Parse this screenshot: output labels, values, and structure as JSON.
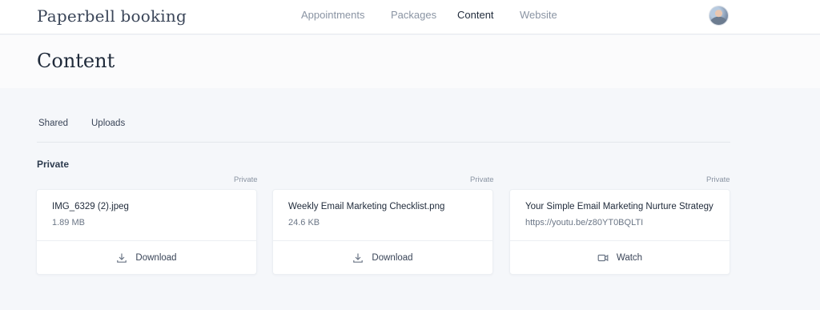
{
  "app": {
    "brand": "Paperbell booking"
  },
  "nav": {
    "items": [
      {
        "label": "Appointments",
        "active": false
      },
      {
        "label": "Packages",
        "active": false
      },
      {
        "label": "Content",
        "active": true
      },
      {
        "label": "Website",
        "active": false
      }
    ]
  },
  "page": {
    "title": "Content"
  },
  "tabs": [
    {
      "label": "Shared",
      "active": true
    },
    {
      "label": "Uploads",
      "active": false
    }
  ],
  "section": {
    "label": "Private"
  },
  "cards": [
    {
      "tag": "Private",
      "title": "IMG_6329 (2).jpeg",
      "subtitle": "1.89 MB",
      "action": "Download",
      "action_icon": "download-icon"
    },
    {
      "tag": "Private",
      "title": "Weekly Email Marketing Checklist.png",
      "subtitle": "24.6 KB",
      "action": "Download",
      "action_icon": "download-icon"
    },
    {
      "tag": "Private",
      "title": "Your Simple Email Marketing Nurture Strategy",
      "subtitle": "https://youtu.be/z80YT0BQLTI",
      "action": "Watch",
      "action_icon": "video-icon"
    }
  ],
  "colors": {
    "background": "#f5f7fa",
    "text": "#1f2a3a",
    "muted": "#8a94a3"
  }
}
